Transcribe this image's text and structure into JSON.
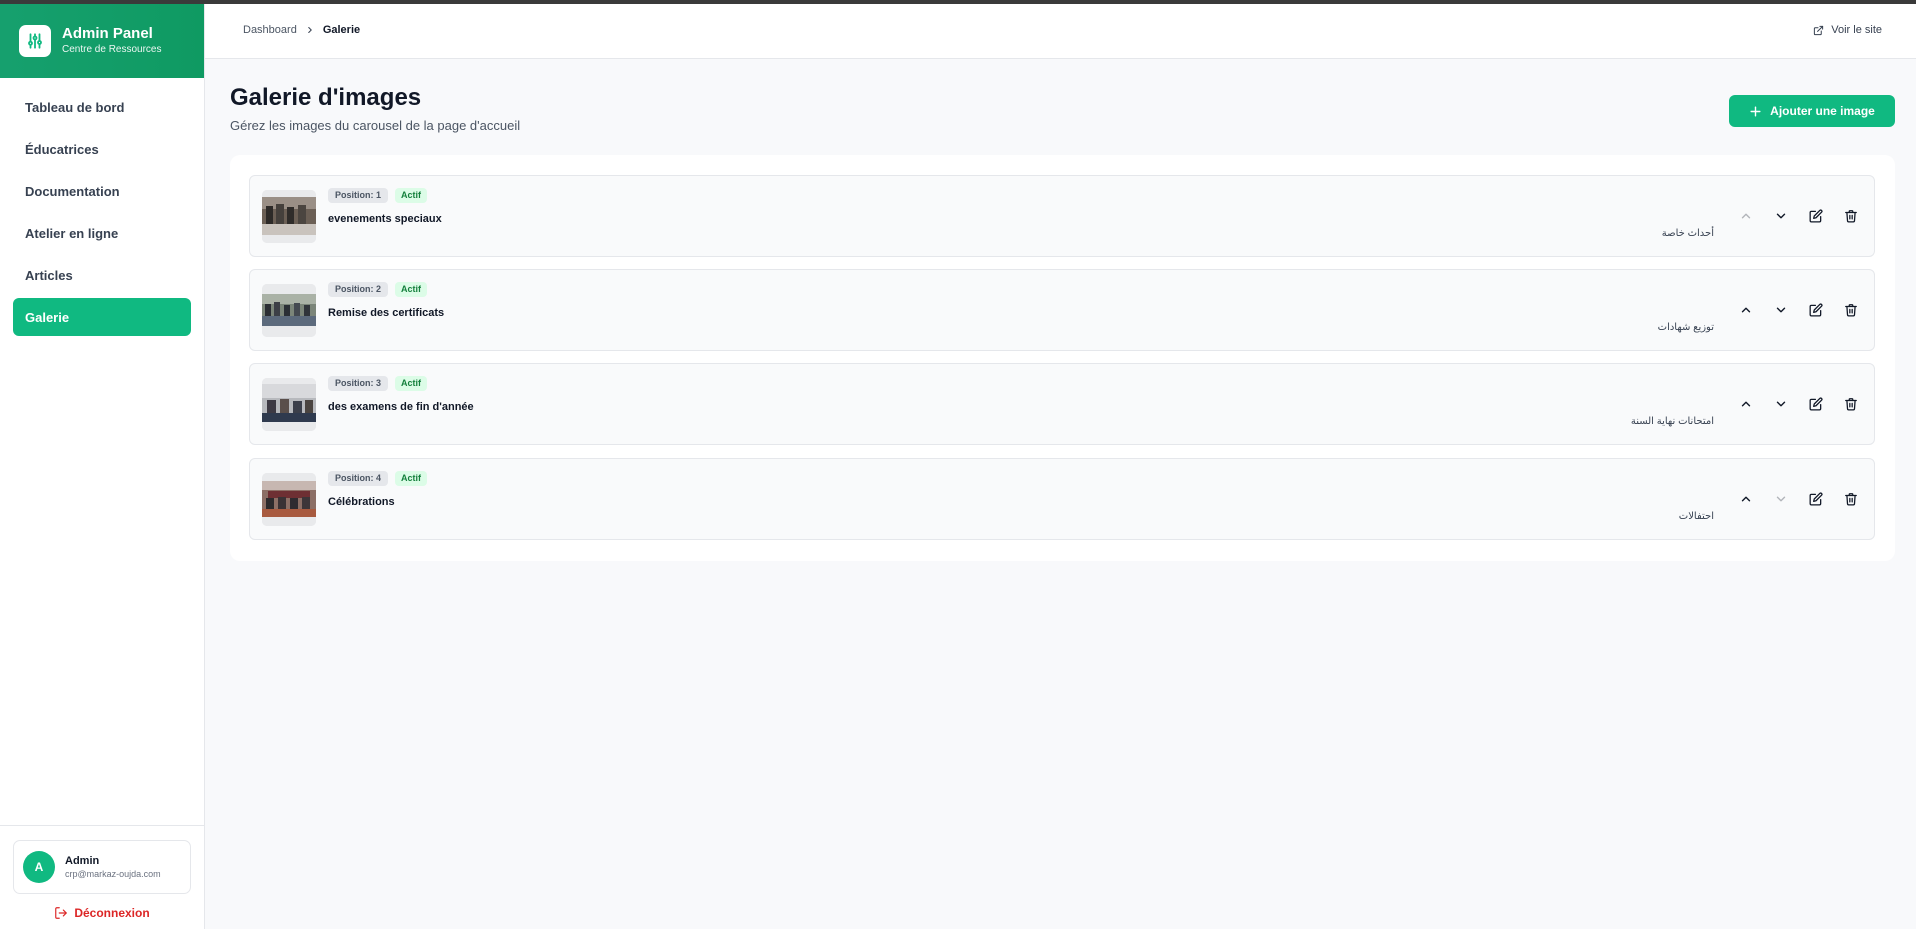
{
  "sidebar": {
    "brand_title": "Admin Panel",
    "brand_subtitle": "Centre de Ressources",
    "brand_icon": "sliders-icon",
    "items": [
      {
        "label": "Tableau de bord",
        "active": false
      },
      {
        "label": "Éducatrices",
        "active": false
      },
      {
        "label": "Documentation",
        "active": false
      },
      {
        "label": "Atelier en ligne",
        "active": false
      },
      {
        "label": "Articles",
        "active": false
      },
      {
        "label": "Galerie",
        "active": true
      }
    ],
    "user": {
      "initial": "A",
      "name": "Admin",
      "email": "crp@markaz-oujda.com"
    },
    "logout_label": "Déconnexion"
  },
  "header": {
    "breadcrumb": {
      "root": "Dashboard",
      "current": "Galerie"
    },
    "view_site_label": "Voir le site"
  },
  "main": {
    "title": "Galerie d'images",
    "subtitle": "Gérez les images du carousel de la page d'accueil",
    "add_button_label": "Ajouter une image"
  },
  "gallery": {
    "items": [
      {
        "position": "Position: 1",
        "status": "Actif",
        "title": "evenements speciaux",
        "title_ar": "أحداث خاصة",
        "can_move_up": false,
        "can_move_down": true
      },
      {
        "position": "Position: 2",
        "status": "Actif",
        "title": "Remise des certificats",
        "title_ar": "توزيع شهادات",
        "can_move_up": true,
        "can_move_down": true
      },
      {
        "position": "Position: 3",
        "status": "Actif",
        "title": "des examens de fin d'année",
        "title_ar": "امتحانات نهاية السنة",
        "can_move_up": true,
        "can_move_down": true
      },
      {
        "position": "Position: 4",
        "status": "Actif",
        "title": "Célébrations",
        "title_ar": "احتفالات",
        "can_move_up": true,
        "can_move_down": false
      }
    ]
  },
  "colors": {
    "accent": "#10b981",
    "active_badge_bg": "#dcfce7",
    "active_badge_text": "#15803d",
    "logout": "#dc2626"
  }
}
